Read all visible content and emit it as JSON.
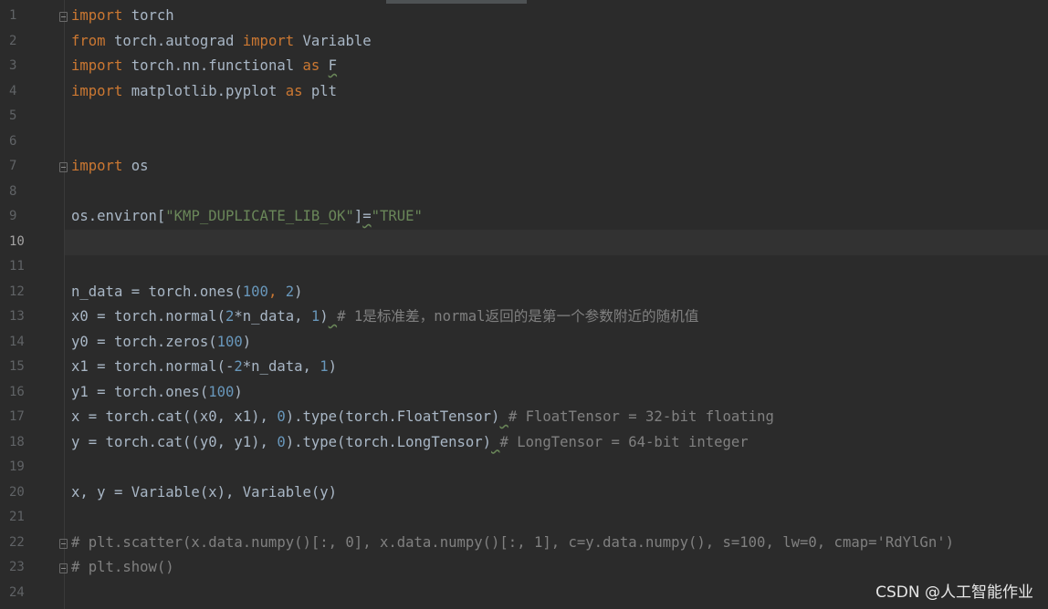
{
  "editor": {
    "line_numbers": [
      "1",
      "2",
      "3",
      "4",
      "5",
      "6",
      "7",
      "8",
      "9",
      "10",
      "11",
      "12",
      "13",
      "14",
      "15",
      "16",
      "17",
      "18",
      "19",
      "20",
      "21",
      "22",
      "23",
      "24"
    ],
    "current_line": "10",
    "lines": [
      [
        {
          "t": "import",
          "c": "kw"
        },
        {
          "t": " torch",
          "c": "plain"
        }
      ],
      [
        {
          "t": "from",
          "c": "kw"
        },
        {
          "t": " torch.autograd ",
          "c": "plain"
        },
        {
          "t": "import",
          "c": "kw"
        },
        {
          "t": " Variable",
          "c": "plain"
        }
      ],
      [
        {
          "t": "import",
          "c": "kw"
        },
        {
          "t": " torch.nn.functional ",
          "c": "plain"
        },
        {
          "t": "as",
          "c": "kw"
        },
        {
          "t": " ",
          "c": "plain"
        },
        {
          "t": "F",
          "c": "plain",
          "w": true
        }
      ],
      [
        {
          "t": "import",
          "c": "kw"
        },
        {
          "t": " matplotlib.pyplot ",
          "c": "plain"
        },
        {
          "t": "as",
          "c": "kw"
        },
        {
          "t": " plt",
          "c": "plain"
        }
      ],
      [],
      [],
      [
        {
          "t": "import",
          "c": "kw"
        },
        {
          "t": " os",
          "c": "plain"
        }
      ],
      [],
      [
        {
          "t": "os.environ[",
          "c": "plain"
        },
        {
          "t": "\"KMP_DUPLICATE_LIB_OK\"",
          "c": "str"
        },
        {
          "t": "]",
          "c": "plain"
        },
        {
          "t": "=",
          "c": "plain",
          "w": true
        },
        {
          "t": "\"TRUE\"",
          "c": "str"
        }
      ],
      [],
      [],
      [
        {
          "t": "n_data = torch.ones(",
          "c": "plain"
        },
        {
          "t": "100",
          "c": "num"
        },
        {
          "t": ", ",
          "c": "kw"
        },
        {
          "t": "2",
          "c": "num"
        },
        {
          "t": ")",
          "c": "plain"
        }
      ],
      [
        {
          "t": "x0 = torch.normal(",
          "c": "plain"
        },
        {
          "t": "2",
          "c": "num"
        },
        {
          "t": "*n_data, ",
          "c": "plain"
        },
        {
          "t": "1",
          "c": "num"
        },
        {
          "t": ")",
          "c": "plain"
        },
        {
          "t": " ",
          "c": "plain",
          "w": true
        },
        {
          "t": "# 1是标准差，normal返回的是第一个参数附近的随机值",
          "c": "com"
        }
      ],
      [
        {
          "t": "y0 = torch.zeros(",
          "c": "plain"
        },
        {
          "t": "100",
          "c": "num"
        },
        {
          "t": ")",
          "c": "plain"
        }
      ],
      [
        {
          "t": "x1 = torch.normal(-",
          "c": "plain"
        },
        {
          "t": "2",
          "c": "num"
        },
        {
          "t": "*n_data, ",
          "c": "plain"
        },
        {
          "t": "1",
          "c": "num"
        },
        {
          "t": ")",
          "c": "plain"
        }
      ],
      [
        {
          "t": "y1 = torch.ones(",
          "c": "plain"
        },
        {
          "t": "100",
          "c": "num"
        },
        {
          "t": ")",
          "c": "plain"
        }
      ],
      [
        {
          "t": "x = torch.cat((x0, x1), ",
          "c": "plain"
        },
        {
          "t": "0",
          "c": "num"
        },
        {
          "t": ").type(torch.FloatTensor)",
          "c": "plain"
        },
        {
          "t": " ",
          "c": "plain",
          "w": true
        },
        {
          "t": "# FloatTensor = 32-bit floating",
          "c": "com"
        }
      ],
      [
        {
          "t": "y = torch.cat((y0, y1), ",
          "c": "plain"
        },
        {
          "t": "0",
          "c": "num"
        },
        {
          "t": ").type(torch.LongTensor)",
          "c": "plain"
        },
        {
          "t": " ",
          "c": "plain",
          "w": true
        },
        {
          "t": "# LongTensor = 64-bit integer",
          "c": "com"
        }
      ],
      [],
      [
        {
          "t": "x, y = Variable(x), Variable(y)",
          "c": "plain"
        }
      ],
      [],
      [
        {
          "t": "# plt.scatter(x.data.numpy()[:, 0], x.data.numpy()[:, 1], c=y.data.numpy(), s=100, lw=0, cmap='RdYlGn')",
          "c": "com"
        }
      ],
      [
        {
          "t": "# plt.show()",
          "c": "com"
        }
      ],
      []
    ]
  },
  "watermark": "CSDN @人工智能作业",
  "colors": {
    "background": "#2b2b2b",
    "keyword": "#cc7832",
    "string": "#6a8759",
    "number": "#6897bb",
    "comment": "#808080",
    "text": "#a9b7c6"
  }
}
